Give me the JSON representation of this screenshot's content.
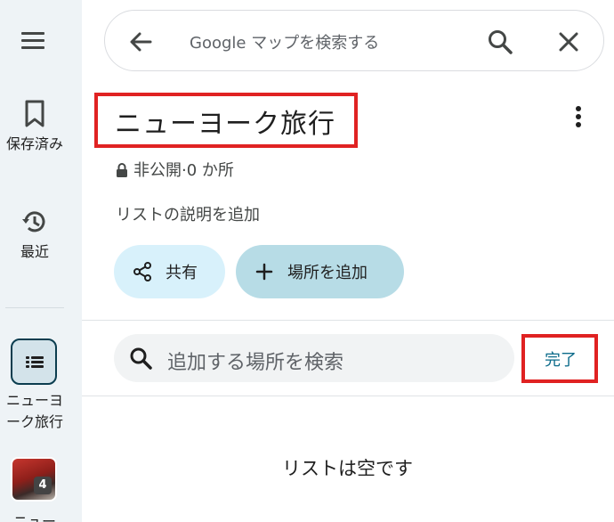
{
  "rail": {
    "saved_label": "保存済み",
    "recent_label": "最近",
    "list_label_line1": "ニューヨ",
    "list_label_line2": "ーク旅行",
    "photo_badge": "4",
    "bottom_label": "ニュー"
  },
  "search": {
    "placeholder": "Google マップを検索する"
  },
  "list": {
    "title": "ニューヨーク旅行",
    "privacy": "非公開·0 か所",
    "add_description": "リストの説明を追加",
    "share_label": "共有",
    "add_place_label": "場所を追加",
    "place_search_placeholder": "追加する場所を検索",
    "done_label": "完了",
    "empty_message": "リストは空です"
  },
  "colors": {
    "rail_bg": "#eef3f6",
    "chip_share_bg": "#d8f1fb",
    "chip_add_bg": "#b7dce6",
    "highlight_border": "#e02222",
    "done_text": "#0b6b8a"
  }
}
